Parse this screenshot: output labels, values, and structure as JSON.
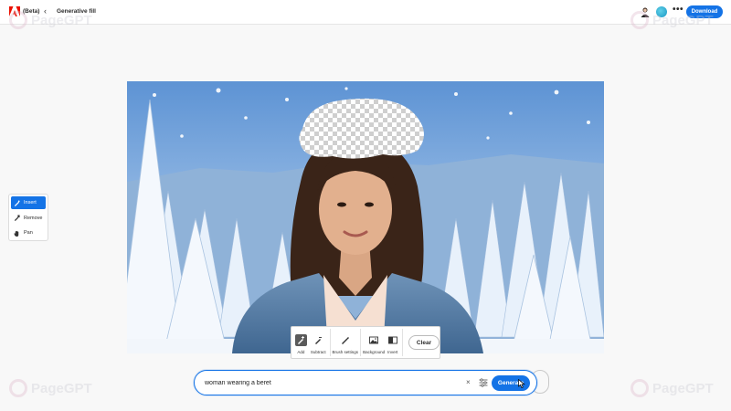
{
  "header": {
    "beta": "(Beta)",
    "back": "‹",
    "breadcrumb": "Generative fill",
    "more": "•••",
    "download": "Download"
  },
  "tools": [
    {
      "label": "Insert",
      "icon": "insert-brush-icon"
    },
    {
      "label": "Remove",
      "icon": "remove-brush-icon"
    },
    {
      "label": "Pan",
      "icon": "hand-icon"
    }
  ],
  "brushbar": {
    "add": "Add",
    "subtract": "Subtract",
    "brush_settings": "Brush settings",
    "background": "Background",
    "invert": "Invert",
    "clear": "Clear"
  },
  "prompt": {
    "value": "woman wearing a beret",
    "clear": "×",
    "generate": "Generate"
  },
  "watermark": "PageGPT",
  "colors": {
    "accent": "#1473e6",
    "adobe_red": "#eb1000"
  }
}
